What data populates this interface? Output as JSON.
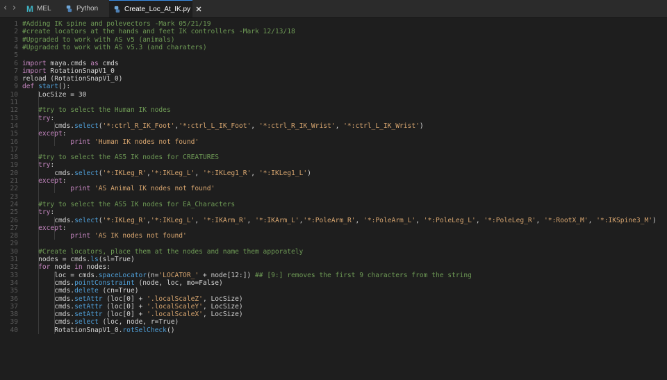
{
  "tabs": [
    {
      "label": "MEL",
      "icon": "mel-m-icon"
    },
    {
      "label": "Python",
      "icon": "python-icon"
    },
    {
      "label": "Create_Loc_At_IK.py",
      "icon": "python-icon",
      "active": true
    }
  ],
  "code": {
    "line_numbers": [
      "1",
      "2",
      "3",
      "4",
      "5",
      "6",
      "7",
      "8",
      "9",
      "10",
      "11",
      "12",
      "13",
      "14",
      "15",
      "16",
      "17",
      "18",
      "19",
      "20",
      "21",
      "22",
      "23",
      "24",
      "25",
      "26",
      "27",
      "28",
      "29",
      "30",
      "31",
      "32",
      "33",
      "34",
      "35",
      "36",
      "37",
      "38",
      "39",
      "40"
    ],
    "lines": [
      [
        {
          "t": "#Adding IK spine and polevectors -Mark 05/21/19",
          "c": "cm"
        }
      ],
      [
        {
          "t": "#create locators at the hands and feet IK controllers -Mark 12/13/18",
          "c": "cm"
        }
      ],
      [
        {
          "t": "#Upgraded to work with AS v5 (animals)",
          "c": "cm"
        }
      ],
      [
        {
          "t": "#Upgraded to work with AS v5.3 (and charaters)",
          "c": "cm"
        }
      ],
      [],
      [
        {
          "t": "import",
          "c": "kw"
        },
        {
          "t": " maya.cmds "
        },
        {
          "t": "as",
          "c": "kw"
        },
        {
          "t": " cmds"
        }
      ],
      [
        {
          "t": "import",
          "c": "kw"
        },
        {
          "t": " RotationSnapV1_0"
        }
      ],
      [
        {
          "t": "reload (RotationSnapV1_0)"
        }
      ],
      [
        {
          "t": "def",
          "c": "kw"
        },
        {
          "t": " "
        },
        {
          "t": "start",
          "c": "fn"
        },
        {
          "t": "():"
        }
      ],
      [
        {
          "t": "    LocSize = 30"
        }
      ],
      [],
      [
        {
          "t": "    "
        },
        {
          "t": "#try to select the Human IK nodes",
          "c": "cm"
        }
      ],
      [
        {
          "t": "    "
        },
        {
          "t": "try",
          "c": "kw"
        },
        {
          "t": ":"
        }
      ],
      [
        {
          "t": "        cmds."
        },
        {
          "t": "select",
          "c": "fn"
        },
        {
          "t": "("
        },
        {
          "t": "'*:ctrl_R_IK_Foot'",
          "c": "st"
        },
        {
          "t": ","
        },
        {
          "t": "'*:ctrl_L_IK_Foot'",
          "c": "st"
        },
        {
          "t": ", "
        },
        {
          "t": "'*:ctrl_R_IK_Wrist'",
          "c": "st"
        },
        {
          "t": ", "
        },
        {
          "t": "'*:ctrl_L_IK_Wrist'",
          "c": "st"
        },
        {
          "t": ")"
        }
      ],
      [
        {
          "t": "    "
        },
        {
          "t": "except",
          "c": "kw"
        },
        {
          "t": ":"
        }
      ],
      [
        {
          "t": "            "
        },
        {
          "t": "print",
          "c": "kw"
        },
        {
          "t": " "
        },
        {
          "t": "'Human IK nodes not found'",
          "c": "st"
        }
      ],
      [],
      [
        {
          "t": "    "
        },
        {
          "t": "#try to select the AS5 IK nodes for CREATURES",
          "c": "cm"
        }
      ],
      [
        {
          "t": "    "
        },
        {
          "t": "try",
          "c": "kw"
        },
        {
          "t": ":"
        }
      ],
      [
        {
          "t": "        cmds."
        },
        {
          "t": "select",
          "c": "fn"
        },
        {
          "t": "("
        },
        {
          "t": "'*:IKLeg_R'",
          "c": "st"
        },
        {
          "t": ","
        },
        {
          "t": "'*:IKLeg_L'",
          "c": "st"
        },
        {
          "t": ", "
        },
        {
          "t": "'*:IKLeg1_R'",
          "c": "st"
        },
        {
          "t": ", "
        },
        {
          "t": "'*:IKLeg1_L'",
          "c": "st"
        },
        {
          "t": ")"
        }
      ],
      [
        {
          "t": "    "
        },
        {
          "t": "except",
          "c": "kw"
        },
        {
          "t": ":"
        }
      ],
      [
        {
          "t": "            "
        },
        {
          "t": "print",
          "c": "kw"
        },
        {
          "t": " "
        },
        {
          "t": "'AS Animal IK nodes not found'",
          "c": "st"
        }
      ],
      [],
      [
        {
          "t": "    "
        },
        {
          "t": "#try to select the AS5 IK nodes for EA_Characters",
          "c": "cm"
        }
      ],
      [
        {
          "t": "    "
        },
        {
          "t": "try",
          "c": "kw"
        },
        {
          "t": ":"
        }
      ],
      [
        {
          "t": "        cmds."
        },
        {
          "t": "select",
          "c": "fn"
        },
        {
          "t": "("
        },
        {
          "t": "'*:IKLeg_R'",
          "c": "st"
        },
        {
          "t": ","
        },
        {
          "t": "'*:IKLeg_L'",
          "c": "st"
        },
        {
          "t": ", "
        },
        {
          "t": "'*:IKArm_R'",
          "c": "st"
        },
        {
          "t": ", "
        },
        {
          "t": "'*:IKArm_L'",
          "c": "st"
        },
        {
          "t": ","
        },
        {
          "t": "'*:PoleArm_R'",
          "c": "st"
        },
        {
          "t": ", "
        },
        {
          "t": "'*:PoleArm_L'",
          "c": "st"
        },
        {
          "t": ", "
        },
        {
          "t": "'*:PoleLeg_L'",
          "c": "st"
        },
        {
          "t": ", "
        },
        {
          "t": "'*:PoleLeg_R'",
          "c": "st"
        },
        {
          "t": ", "
        },
        {
          "t": "'*:RootX_M'",
          "c": "st"
        },
        {
          "t": ", "
        },
        {
          "t": "'*:IKSpine3_M'",
          "c": "st"
        },
        {
          "t": ")"
        }
      ],
      [
        {
          "t": "    "
        },
        {
          "t": "except",
          "c": "kw"
        },
        {
          "t": ":"
        }
      ],
      [
        {
          "t": "            "
        },
        {
          "t": "print",
          "c": "kw"
        },
        {
          "t": " "
        },
        {
          "t": "'AS IK nodes not found'",
          "c": "st"
        }
      ],
      [],
      [
        {
          "t": "    "
        },
        {
          "t": "#Create locators, place them at the nodes and name them apporately",
          "c": "cm"
        }
      ],
      [
        {
          "t": "    nodes = cmds."
        },
        {
          "t": "ls",
          "c": "fn"
        },
        {
          "t": "(sl=True)"
        }
      ],
      [
        {
          "t": "    "
        },
        {
          "t": "for",
          "c": "kw"
        },
        {
          "t": " node "
        },
        {
          "t": "in",
          "c": "kw"
        },
        {
          "t": " nodes:"
        }
      ],
      [
        {
          "t": "        loc = cmds."
        },
        {
          "t": "spaceLocator",
          "c": "fn"
        },
        {
          "t": "(n="
        },
        {
          "t": "'LOCATOR_'",
          "c": "st"
        },
        {
          "t": " + node[12:]) "
        },
        {
          "t": "## [9:] removes the first 9 characters from the string",
          "c": "cm"
        }
      ],
      [
        {
          "t": "        cmds."
        },
        {
          "t": "pointConstraint",
          "c": "fn"
        },
        {
          "t": " (node, loc, mo=False)"
        }
      ],
      [
        {
          "t": "        cmds."
        },
        {
          "t": "delete",
          "c": "fn"
        },
        {
          "t": " (cn=True)"
        }
      ],
      [
        {
          "t": "        cmds."
        },
        {
          "t": "setAttr",
          "c": "fn"
        },
        {
          "t": " (loc[0] + "
        },
        {
          "t": "'.localScaleZ'",
          "c": "st"
        },
        {
          "t": ", LocSize)"
        }
      ],
      [
        {
          "t": "        cmds."
        },
        {
          "t": "setAttr",
          "c": "fn"
        },
        {
          "t": " (loc[0] + "
        },
        {
          "t": "'.localScaleY'",
          "c": "st"
        },
        {
          "t": ", LocSize)"
        }
      ],
      [
        {
          "t": "        cmds."
        },
        {
          "t": "setAttr",
          "c": "fn"
        },
        {
          "t": " (loc[0] + "
        },
        {
          "t": "'.localScaleX'",
          "c": "st"
        },
        {
          "t": ", LocSize)"
        }
      ],
      [
        {
          "t": "        cmds."
        },
        {
          "t": "select",
          "c": "fn"
        },
        {
          "t": " (loc, node, r=True)"
        }
      ],
      [
        {
          "t": "        RotationSnapV1_0."
        },
        {
          "t": "rotSelCheck",
          "c": "fn"
        },
        {
          "t": "()"
        }
      ]
    ]
  }
}
